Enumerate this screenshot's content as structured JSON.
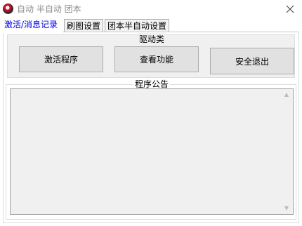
{
  "window": {
    "title": "自动 半自动 团本",
    "close_label": "✕"
  },
  "tabs": [
    {
      "label": "激活/消息记录",
      "active": true
    },
    {
      "label": "刷图设置",
      "active": false
    },
    {
      "label": "团本半自动设置",
      "active": false
    }
  ],
  "driver_group": {
    "title": "驱动类",
    "buttons": {
      "activate": "激活程序",
      "view_features": "查看功能",
      "safe_exit": "安全退出"
    }
  },
  "notice_group": {
    "title": "程序公告",
    "content": "",
    "scroll_up": "▲",
    "scroll_down": "▼"
  },
  "colors": {
    "active_tab_text": "#0000ee",
    "title_text": "#8c8c8c",
    "button_face": "#e1e1e1",
    "group_background": "#f0f0f0"
  }
}
